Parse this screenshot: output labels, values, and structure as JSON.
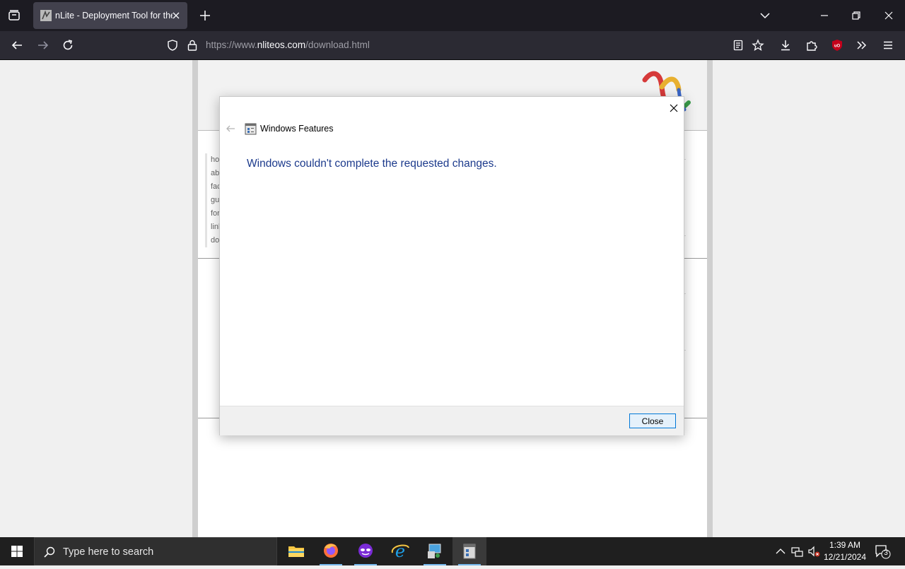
{
  "browser": {
    "tab_title": "nLite - Deployment Tool for the",
    "url_prefix": "https://www.",
    "url_host": "nliteos.com",
    "url_path": "/download.html"
  },
  "page": {
    "sidenav": [
      "ho",
      "ab",
      "fac",
      "gu",
      "for",
      "linl",
      "do"
    ]
  },
  "dialog": {
    "title": "Windows Features",
    "message": "Windows couldn't complete the requested changes.",
    "close_label": "Close"
  },
  "taskbar": {
    "search_placeholder": "Type here to search",
    "time": "1:39 AM",
    "date": "12/21/2024",
    "notification_count": "3"
  },
  "colors": {
    "accent": "#0078d7",
    "heading": "#1c3a8c",
    "ublock": "#c4001b"
  }
}
